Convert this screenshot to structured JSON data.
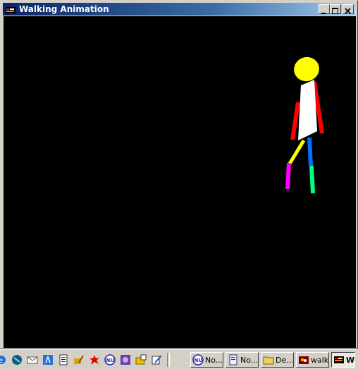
{
  "window": {
    "title": "Walking Animation",
    "icon": "opengl-window-icon",
    "controls": [
      "minimize",
      "maximize",
      "close"
    ]
  },
  "canvas": {
    "background": "#000000"
  },
  "figure": {
    "head_color": "#ffff00",
    "torso_color": "#ffffff",
    "arm_color": "#ff0000",
    "left_thigh_color": "#ffff00",
    "left_shin_color": "#ff00ff",
    "right_thigh_color": "#0070ff",
    "right_shin_color": "#00ff7f"
  },
  "taskbar": {
    "quick_launch": [
      "ie-icon",
      "netscape-icon",
      "mail-icon",
      "outlook-icon",
      "document-icon",
      "pencil-icon",
      "splat-icon",
      "nu-icon",
      "purple-app-icon",
      "folder-tool-icon",
      "script-icon"
    ],
    "tasks": [
      {
        "label": "No...",
        "icon": "nu-icon"
      },
      {
        "label": "No...",
        "icon": "notepad-icon"
      },
      {
        "label": "De...",
        "icon": "folder-icon"
      },
      {
        "label": "walk",
        "icon": "walk-app-icon"
      },
      {
        "label": "W",
        "icon": "opengl-window-icon",
        "active": true
      }
    ]
  }
}
